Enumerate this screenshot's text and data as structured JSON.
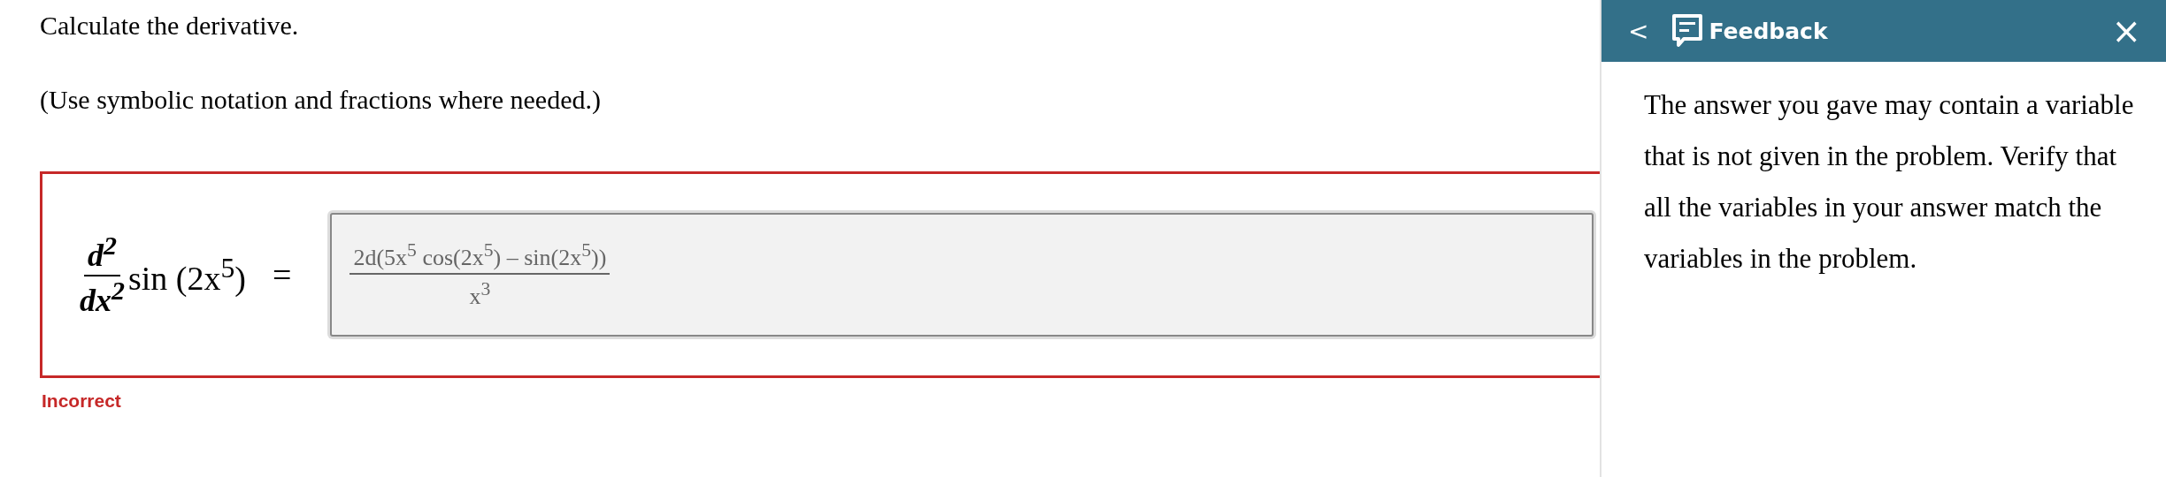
{
  "question": {
    "title": "Calculate the derivative.",
    "instruction": "(Use symbolic notation and fractions where needed.)"
  },
  "equation": {
    "operator_numerator": "d$^{2}$",
    "operator_denominator": "dx$^{2}$",
    "function": "sin (2x$^{5}$)",
    "equals": "="
  },
  "answer": {
    "numerator": "2d(5x$^{5}$ cos(2x$^{5}$) – sin(2x$^{5}$))",
    "denominator": "x$^{3}$"
  },
  "result": {
    "label": "Incorrect",
    "correct": false
  },
  "feedback_panel": {
    "back": "<",
    "title": "Feedback",
    "close": "×",
    "message": "The answer you gave may contain a variable that is not given in the problem. Verify that all the variables in your answer match the variables in the problem."
  }
}
